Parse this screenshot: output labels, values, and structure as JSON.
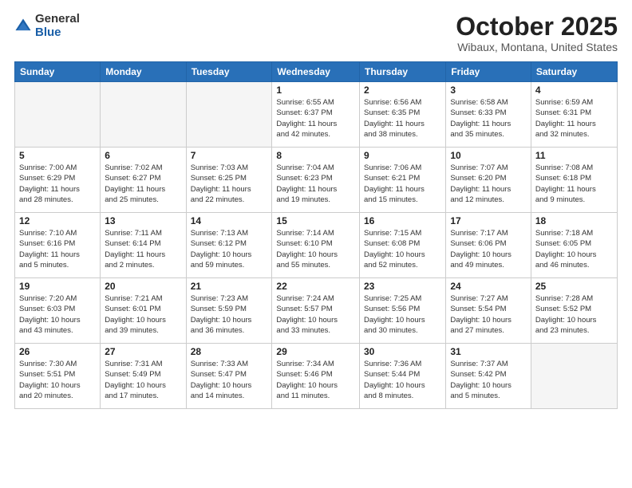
{
  "header": {
    "logo_general": "General",
    "logo_blue": "Blue",
    "month_title": "October 2025",
    "location": "Wibaux, Montana, United States"
  },
  "weekdays": [
    "Sunday",
    "Monday",
    "Tuesday",
    "Wednesday",
    "Thursday",
    "Friday",
    "Saturday"
  ],
  "weeks": [
    [
      {
        "day": "",
        "info": ""
      },
      {
        "day": "",
        "info": ""
      },
      {
        "day": "",
        "info": ""
      },
      {
        "day": "1",
        "info": "Sunrise: 6:55 AM\nSunset: 6:37 PM\nDaylight: 11 hours\nand 42 minutes."
      },
      {
        "day": "2",
        "info": "Sunrise: 6:56 AM\nSunset: 6:35 PM\nDaylight: 11 hours\nand 38 minutes."
      },
      {
        "day": "3",
        "info": "Sunrise: 6:58 AM\nSunset: 6:33 PM\nDaylight: 11 hours\nand 35 minutes."
      },
      {
        "day": "4",
        "info": "Sunrise: 6:59 AM\nSunset: 6:31 PM\nDaylight: 11 hours\nand 32 minutes."
      }
    ],
    [
      {
        "day": "5",
        "info": "Sunrise: 7:00 AM\nSunset: 6:29 PM\nDaylight: 11 hours\nand 28 minutes."
      },
      {
        "day": "6",
        "info": "Sunrise: 7:02 AM\nSunset: 6:27 PM\nDaylight: 11 hours\nand 25 minutes."
      },
      {
        "day": "7",
        "info": "Sunrise: 7:03 AM\nSunset: 6:25 PM\nDaylight: 11 hours\nand 22 minutes."
      },
      {
        "day": "8",
        "info": "Sunrise: 7:04 AM\nSunset: 6:23 PM\nDaylight: 11 hours\nand 19 minutes."
      },
      {
        "day": "9",
        "info": "Sunrise: 7:06 AM\nSunset: 6:21 PM\nDaylight: 11 hours\nand 15 minutes."
      },
      {
        "day": "10",
        "info": "Sunrise: 7:07 AM\nSunset: 6:20 PM\nDaylight: 11 hours\nand 12 minutes."
      },
      {
        "day": "11",
        "info": "Sunrise: 7:08 AM\nSunset: 6:18 PM\nDaylight: 11 hours\nand 9 minutes."
      }
    ],
    [
      {
        "day": "12",
        "info": "Sunrise: 7:10 AM\nSunset: 6:16 PM\nDaylight: 11 hours\nand 5 minutes."
      },
      {
        "day": "13",
        "info": "Sunrise: 7:11 AM\nSunset: 6:14 PM\nDaylight: 11 hours\nand 2 minutes."
      },
      {
        "day": "14",
        "info": "Sunrise: 7:13 AM\nSunset: 6:12 PM\nDaylight: 10 hours\nand 59 minutes."
      },
      {
        "day": "15",
        "info": "Sunrise: 7:14 AM\nSunset: 6:10 PM\nDaylight: 10 hours\nand 55 minutes."
      },
      {
        "day": "16",
        "info": "Sunrise: 7:15 AM\nSunset: 6:08 PM\nDaylight: 10 hours\nand 52 minutes."
      },
      {
        "day": "17",
        "info": "Sunrise: 7:17 AM\nSunset: 6:06 PM\nDaylight: 10 hours\nand 49 minutes."
      },
      {
        "day": "18",
        "info": "Sunrise: 7:18 AM\nSunset: 6:05 PM\nDaylight: 10 hours\nand 46 minutes."
      }
    ],
    [
      {
        "day": "19",
        "info": "Sunrise: 7:20 AM\nSunset: 6:03 PM\nDaylight: 10 hours\nand 43 minutes."
      },
      {
        "day": "20",
        "info": "Sunrise: 7:21 AM\nSunset: 6:01 PM\nDaylight: 10 hours\nand 39 minutes."
      },
      {
        "day": "21",
        "info": "Sunrise: 7:23 AM\nSunset: 5:59 PM\nDaylight: 10 hours\nand 36 minutes."
      },
      {
        "day": "22",
        "info": "Sunrise: 7:24 AM\nSunset: 5:57 PM\nDaylight: 10 hours\nand 33 minutes."
      },
      {
        "day": "23",
        "info": "Sunrise: 7:25 AM\nSunset: 5:56 PM\nDaylight: 10 hours\nand 30 minutes."
      },
      {
        "day": "24",
        "info": "Sunrise: 7:27 AM\nSunset: 5:54 PM\nDaylight: 10 hours\nand 27 minutes."
      },
      {
        "day": "25",
        "info": "Sunrise: 7:28 AM\nSunset: 5:52 PM\nDaylight: 10 hours\nand 23 minutes."
      }
    ],
    [
      {
        "day": "26",
        "info": "Sunrise: 7:30 AM\nSunset: 5:51 PM\nDaylight: 10 hours\nand 20 minutes."
      },
      {
        "day": "27",
        "info": "Sunrise: 7:31 AM\nSunset: 5:49 PM\nDaylight: 10 hours\nand 17 minutes."
      },
      {
        "day": "28",
        "info": "Sunrise: 7:33 AM\nSunset: 5:47 PM\nDaylight: 10 hours\nand 14 minutes."
      },
      {
        "day": "29",
        "info": "Sunrise: 7:34 AM\nSunset: 5:46 PM\nDaylight: 10 hours\nand 11 minutes."
      },
      {
        "day": "30",
        "info": "Sunrise: 7:36 AM\nSunset: 5:44 PM\nDaylight: 10 hours\nand 8 minutes."
      },
      {
        "day": "31",
        "info": "Sunrise: 7:37 AM\nSunset: 5:42 PM\nDaylight: 10 hours\nand 5 minutes."
      },
      {
        "day": "",
        "info": ""
      }
    ]
  ]
}
